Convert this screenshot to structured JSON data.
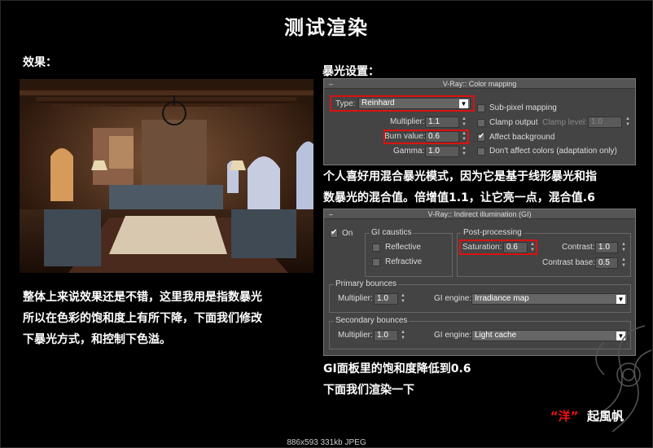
{
  "page": {
    "title": "测试渲染",
    "effect_label": "效果：",
    "exposure_label": "暴光设置：",
    "desc_exposure": [
      "个人喜好用混合暴光模式，因为它是基于线形暴光和指",
      "数暴光的混合值。倍增值1.1，让它亮一点，混合值.6"
    ],
    "desc_left": [
      "整体上来说效果还是不错，这里我用是指数暴光",
      "所以在色彩的饱和度上有所下降，下面我们修改",
      "下暴光方式，和控制下色溢。"
    ],
    "desc_gi": [
      "GI面板里的饱和度降低到0.6",
      "下面我们渲染一下"
    ],
    "signature_pre": "“",
    "signature_name": "洋",
    "signature_post": "”",
    "signature_rest": "起風帆",
    "status_bar": "886x593  331kb  JPEG"
  },
  "color_mapping": {
    "header": "V-Ray:: Color mapping",
    "type_label": "Type:",
    "type_value": "Reinhard",
    "multiplier_label": "Multiplier:",
    "multiplier_value": "1.1",
    "burn_label": "Burn value:",
    "burn_value": "0.6",
    "gamma_label": "Gamma:",
    "gamma_value": "1.0",
    "subpixel_label": "Sub-pixel mapping",
    "clamp_label": "Clamp output",
    "clamp_level_label": "Clamp level:",
    "clamp_level_value": "1.0",
    "affect_bg_label": "Affect background",
    "dont_affect_label": "Don't affect colors (adaptation only)"
  },
  "gi": {
    "header": "V-Ray:: Indirect illumination (GI)",
    "on_label": "On",
    "caustics_title": "GI caustics",
    "reflective_label": "Reflective",
    "refractive_label": "Refractive",
    "post_title": "Post-processing",
    "saturation_label": "Saturation:",
    "saturation_value": "0.6",
    "contrast_label": "Contrast:",
    "contrast_value": "1.0",
    "contrast_base_label": "Contrast base:",
    "contrast_base_value": "0.5",
    "primary_title": "Primary bounces",
    "primary_mult_label": "Multiplier:",
    "primary_mult_value": "1.0",
    "primary_engine_label": "GI engine:",
    "primary_engine_value": "Irradiance map",
    "secondary_title": "Secondary bounces",
    "secondary_mult_label": "Multiplier:",
    "secondary_mult_value": "1.0",
    "secondary_engine_label": "GI engine:",
    "secondary_engine_value": "Light cache"
  }
}
